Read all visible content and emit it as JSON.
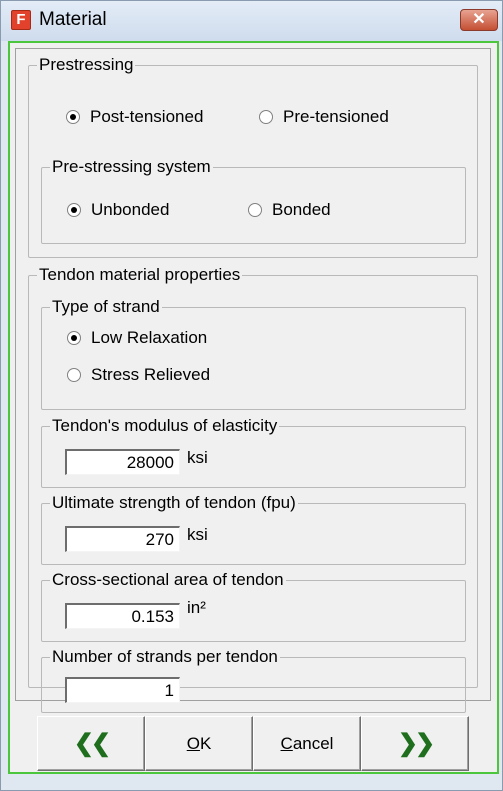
{
  "window": {
    "title": "Material",
    "app_icon_letter": "F",
    "close_symbol": "✕"
  },
  "prestressing": {
    "legend": "Prestressing",
    "options": [
      {
        "label": "Post-tensioned",
        "selected": true
      },
      {
        "label": "Pre-tensioned",
        "selected": false
      }
    ],
    "system": {
      "legend": "Pre-stressing system",
      "options": [
        {
          "label": "Unbonded",
          "selected": true
        },
        {
          "label": "Bonded",
          "selected": false
        }
      ]
    }
  },
  "tendon": {
    "legend": "Tendon material properties",
    "strand": {
      "legend": "Type of strand",
      "options": [
        {
          "label": "Low Relaxation",
          "selected": true
        },
        {
          "label": "Stress Relieved",
          "selected": false
        }
      ]
    },
    "modulus": {
      "legend": "Tendon's modulus of elasticity",
      "value": "28000",
      "unit": "ksi"
    },
    "ultimate": {
      "legend": "Ultimate strength of tendon (fpu)",
      "value": "270",
      "unit": "ksi"
    },
    "area": {
      "legend": "Cross-sectional area of tendon",
      "value": "0.153",
      "unit": "in²"
    },
    "strands": {
      "legend": "Number of strands per tendon",
      "value": "1"
    }
  },
  "buttons": {
    "prev_symbol": "❮❮",
    "ok_mnemonic": "O",
    "ok_rest": "K",
    "cancel_mnemonic": "C",
    "cancel_rest": "ancel",
    "next_symbol": "❯❯"
  },
  "colors": {
    "client_border": "#4cc63c",
    "arrow": "#1e6e1e",
    "app_icon": "#e2422b"
  }
}
